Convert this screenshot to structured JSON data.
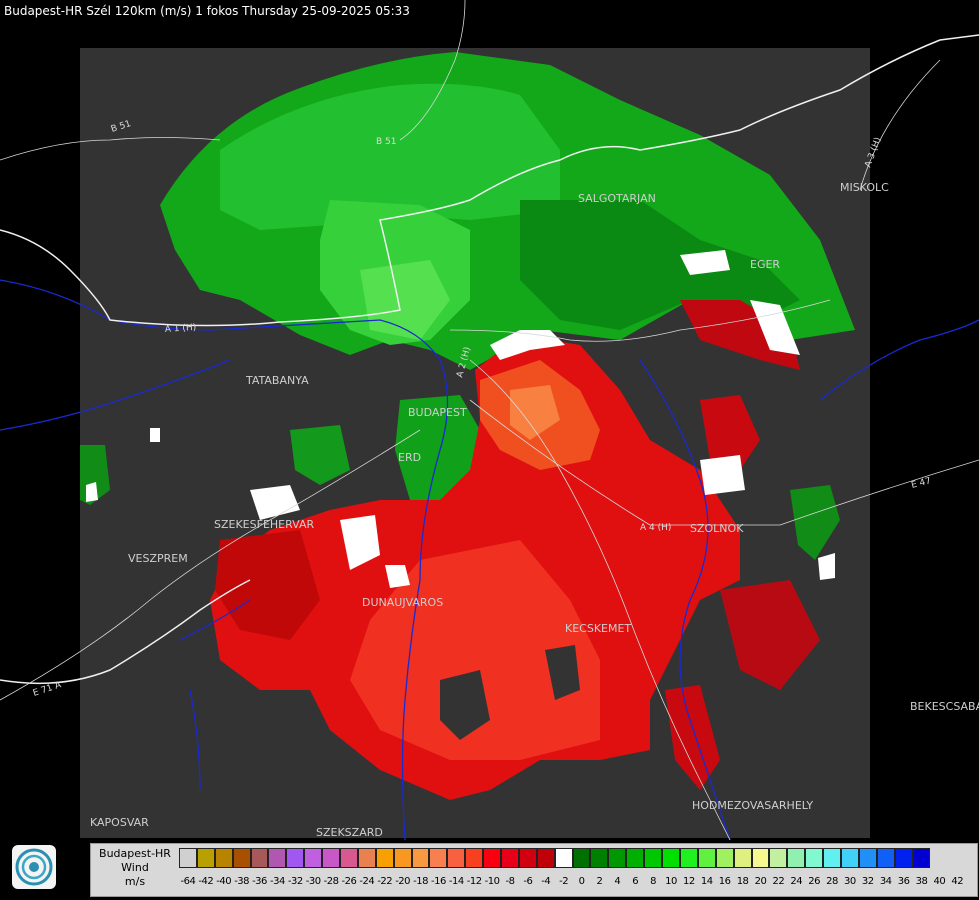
{
  "header": "Budapest-HR Szél 120km (m/s) 1 fokos Thursday 25-09-2025 05:33",
  "cities": [
    {
      "name": "SALGOTARJAN"
    },
    {
      "name": "EGER"
    },
    {
      "name": "MISKOLC"
    },
    {
      "name": "TATABANYA"
    },
    {
      "name": "BUDAPEST"
    },
    {
      "name": "ERD"
    },
    {
      "name": "SZEKESFEHERVAR"
    },
    {
      "name": "VESZPREM"
    },
    {
      "name": "DUNAUJVAROS"
    },
    {
      "name": "KECSKEMET"
    },
    {
      "name": "SZOLNOK"
    },
    {
      "name": "BEKESCSABA"
    },
    {
      "name": "HODMEZOVASARHELY"
    },
    {
      "name": "KAPOSVAR"
    },
    {
      "name": "SZEKSZARD"
    }
  ],
  "roads": [
    "B 51",
    "B 51",
    "A 1 (H)",
    "A 2 (H)",
    "A 3 (H)",
    "A 4 (H)",
    "E 47",
    "E 71 A"
  ],
  "legend": {
    "title_lines": [
      "Budapest-HR",
      "Wind",
      "m/s"
    ],
    "colors": [
      "#d0d0d0",
      "#b8a000",
      "#b88400",
      "#a85000",
      "#a85858",
      "#b058b0",
      "#a058f0",
      "#c060e0",
      "#c858c8",
      "#d85890",
      "#e88050",
      "#f8a000",
      "#f89820",
      "#f89840",
      "#f88050",
      "#f86040",
      "#f84020",
      "#f80010",
      "#e80018",
      "#d00010",
      "#c00008",
      "#ffffff",
      "#007000",
      "#008000",
      "#009800",
      "#00b000",
      "#00c800",
      "#00e000",
      "#20f020",
      "#60f040",
      "#a0f060",
      "#e0f080",
      "#f8f890",
      "#c0f0a0",
      "#90f0b0",
      "#80f8d0",
      "#60f0f0",
      "#40d0f8",
      "#2090f8",
      "#1060f8",
      "#0020f0",
      "#0000d0"
    ],
    "ticks": [
      "-64",
      "-42",
      "-40",
      "-38",
      "-36",
      "-34",
      "-32",
      "-30",
      "-28",
      "-26",
      "-24",
      "-22",
      "-20",
      "-18",
      "-16",
      "-14",
      "-12",
      "-10",
      "-8",
      "-6",
      "-4",
      "-2",
      "0",
      "2",
      "4",
      "6",
      "8",
      "10",
      "12",
      "14",
      "16",
      "18",
      "20",
      "22",
      "24",
      "26",
      "28",
      "30",
      "32",
      "34",
      "36",
      "38",
      "40",
      "42"
    ]
  }
}
